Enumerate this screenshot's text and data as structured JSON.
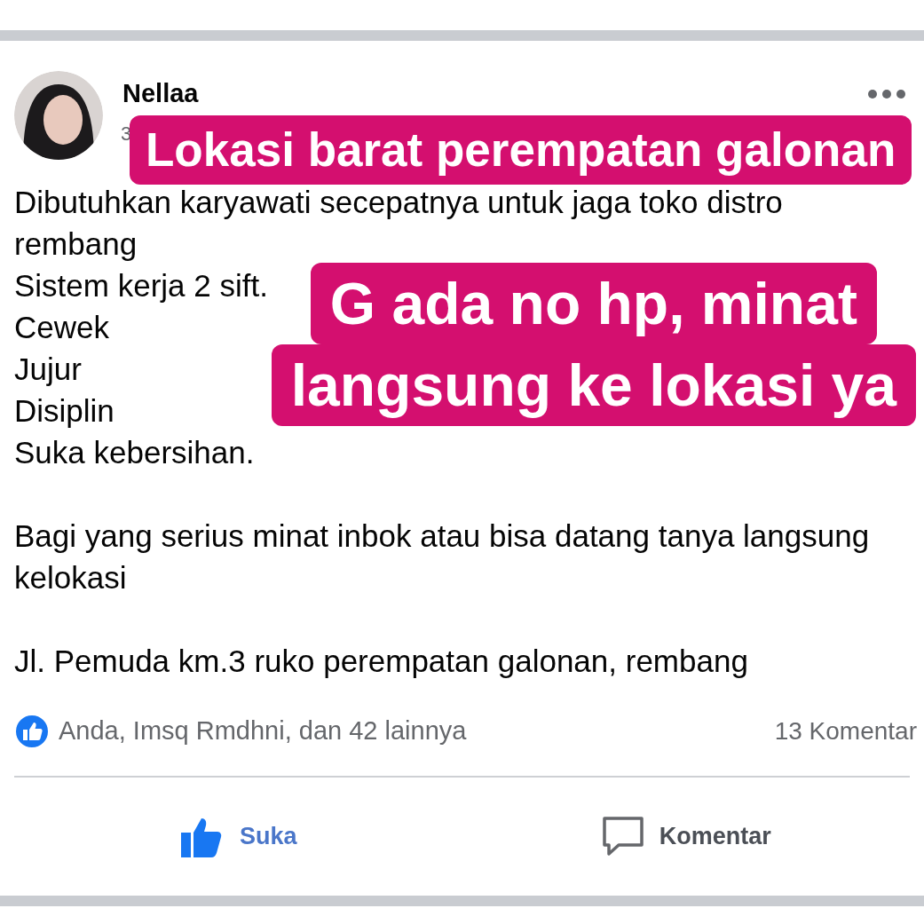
{
  "post": {
    "author": "Nellaa",
    "time": "3",
    "paragraphs": [
      [
        "Dibutuhkan karyawati secepatnya untuk jaga toko distro",
        "rembang",
        "Sistem kerja 2 sift.",
        "Cewek",
        "Jujur",
        "Disiplin",
        "Suka kebersihan."
      ],
      [
        "Bagi yang serius minat inbok atau bisa datang tanya langsung",
        "kelokasi"
      ],
      [
        "Jl. Pemuda km.3 ruko perempatan galonan, rembang"
      ]
    ]
  },
  "overlays": [
    {
      "kind": "top",
      "lines": [
        "Lokasi barat perempatan galonan"
      ]
    },
    {
      "kind": "middle",
      "lines": [
        "G ada no hp, minat",
        "langsung ke lokasi ya"
      ]
    }
  ],
  "reactions": {
    "summary": "Anda, Imsq Rmdhni, dan 42 lainnya",
    "comments": "13 Komentar"
  },
  "actions": [
    {
      "kind": "like",
      "label": "Suka",
      "selected": true
    },
    {
      "kind": "comment",
      "label": "Komentar",
      "selected": false
    }
  ]
}
